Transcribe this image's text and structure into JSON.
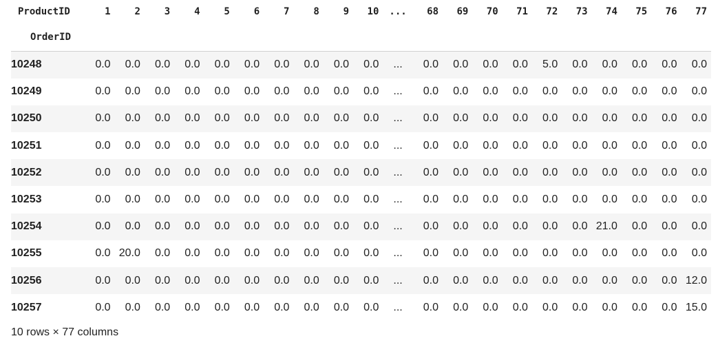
{
  "table": {
    "columns_axis_name": "ProductID",
    "index_name": "OrderID",
    "columns": [
      "1",
      "2",
      "3",
      "4",
      "5",
      "6",
      "7",
      "8",
      "9",
      "10",
      "...",
      "68",
      "69",
      "70",
      "71",
      "72",
      "73",
      "74",
      "75",
      "76",
      "77"
    ],
    "rows": [
      {
        "index": "10248",
        "cells": [
          "0.0",
          "0.0",
          "0.0",
          "0.0",
          "0.0",
          "0.0",
          "0.0",
          "0.0",
          "0.0",
          "0.0",
          "...",
          "0.0",
          "0.0",
          "0.0",
          "0.0",
          "5.0",
          "0.0",
          "0.0",
          "0.0",
          "0.0",
          "0.0"
        ]
      },
      {
        "index": "10249",
        "cells": [
          "0.0",
          "0.0",
          "0.0",
          "0.0",
          "0.0",
          "0.0",
          "0.0",
          "0.0",
          "0.0",
          "0.0",
          "...",
          "0.0",
          "0.0",
          "0.0",
          "0.0",
          "0.0",
          "0.0",
          "0.0",
          "0.0",
          "0.0",
          "0.0"
        ]
      },
      {
        "index": "10250",
        "cells": [
          "0.0",
          "0.0",
          "0.0",
          "0.0",
          "0.0",
          "0.0",
          "0.0",
          "0.0",
          "0.0",
          "0.0",
          "...",
          "0.0",
          "0.0",
          "0.0",
          "0.0",
          "0.0",
          "0.0",
          "0.0",
          "0.0",
          "0.0",
          "0.0"
        ]
      },
      {
        "index": "10251",
        "cells": [
          "0.0",
          "0.0",
          "0.0",
          "0.0",
          "0.0",
          "0.0",
          "0.0",
          "0.0",
          "0.0",
          "0.0",
          "...",
          "0.0",
          "0.0",
          "0.0",
          "0.0",
          "0.0",
          "0.0",
          "0.0",
          "0.0",
          "0.0",
          "0.0"
        ]
      },
      {
        "index": "10252",
        "cells": [
          "0.0",
          "0.0",
          "0.0",
          "0.0",
          "0.0",
          "0.0",
          "0.0",
          "0.0",
          "0.0",
          "0.0",
          "...",
          "0.0",
          "0.0",
          "0.0",
          "0.0",
          "0.0",
          "0.0",
          "0.0",
          "0.0",
          "0.0",
          "0.0"
        ]
      },
      {
        "index": "10253",
        "cells": [
          "0.0",
          "0.0",
          "0.0",
          "0.0",
          "0.0",
          "0.0",
          "0.0",
          "0.0",
          "0.0",
          "0.0",
          "...",
          "0.0",
          "0.0",
          "0.0",
          "0.0",
          "0.0",
          "0.0",
          "0.0",
          "0.0",
          "0.0",
          "0.0"
        ]
      },
      {
        "index": "10254",
        "cells": [
          "0.0",
          "0.0",
          "0.0",
          "0.0",
          "0.0",
          "0.0",
          "0.0",
          "0.0",
          "0.0",
          "0.0",
          "...",
          "0.0",
          "0.0",
          "0.0",
          "0.0",
          "0.0",
          "0.0",
          "21.0",
          "0.0",
          "0.0",
          "0.0"
        ]
      },
      {
        "index": "10255",
        "cells": [
          "0.0",
          "20.0",
          "0.0",
          "0.0",
          "0.0",
          "0.0",
          "0.0",
          "0.0",
          "0.0",
          "0.0",
          "...",
          "0.0",
          "0.0",
          "0.0",
          "0.0",
          "0.0",
          "0.0",
          "0.0",
          "0.0",
          "0.0",
          "0.0"
        ]
      },
      {
        "index": "10256",
        "cells": [
          "0.0",
          "0.0",
          "0.0",
          "0.0",
          "0.0",
          "0.0",
          "0.0",
          "0.0",
          "0.0",
          "0.0",
          "...",
          "0.0",
          "0.0",
          "0.0",
          "0.0",
          "0.0",
          "0.0",
          "0.0",
          "0.0",
          "0.0",
          "12.0"
        ]
      },
      {
        "index": "10257",
        "cells": [
          "0.0",
          "0.0",
          "0.0",
          "0.0",
          "0.0",
          "0.0",
          "0.0",
          "0.0",
          "0.0",
          "0.0",
          "...",
          "0.0",
          "0.0",
          "0.0",
          "0.0",
          "0.0",
          "0.0",
          "0.0",
          "0.0",
          "0.0",
          "15.0"
        ]
      }
    ]
  },
  "footer": {
    "shape_text": "10 rows × 77 columns"
  }
}
